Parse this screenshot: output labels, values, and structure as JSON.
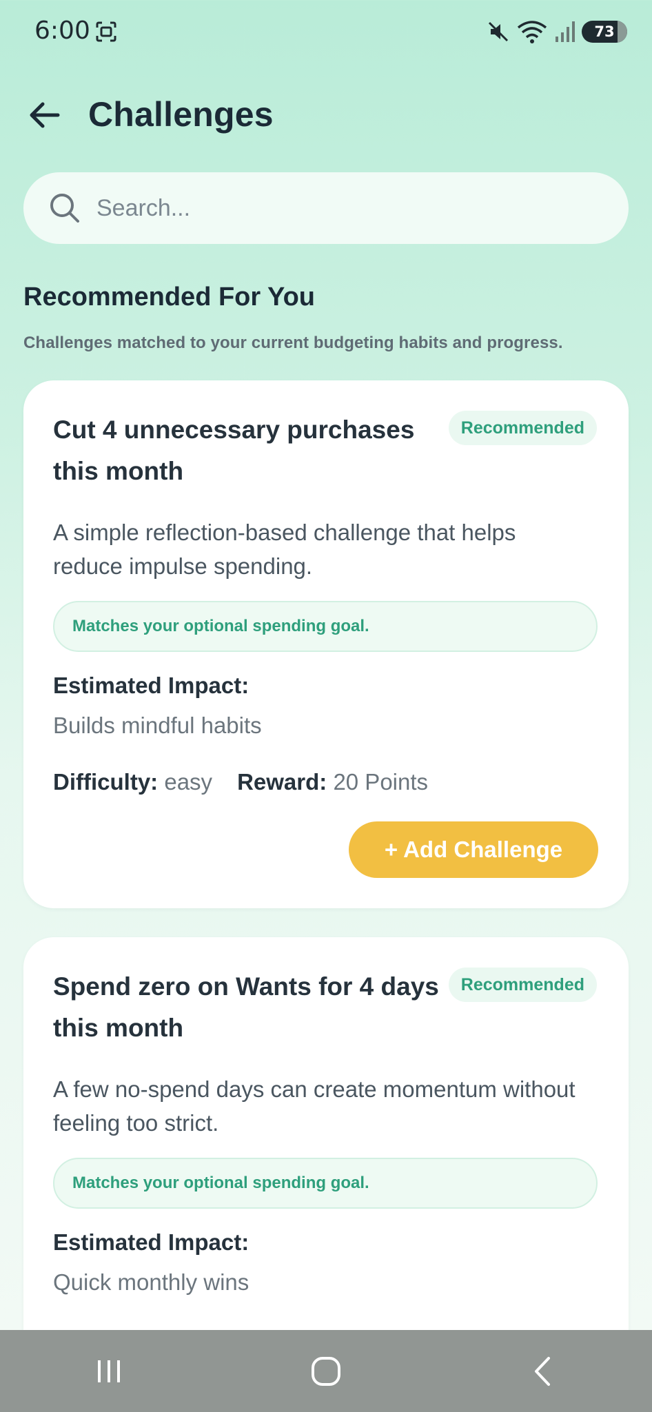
{
  "status_bar": {
    "time": "6:00",
    "battery": "73",
    "icons": [
      "screenshot-icon",
      "mute-icon",
      "wifi-icon",
      "signal-icon",
      "battery-icon"
    ]
  },
  "header": {
    "title": "Challenges",
    "back_icon": "arrow-left-icon"
  },
  "search": {
    "placeholder": "Search...",
    "value": ""
  },
  "section": {
    "title": "Recommended For You",
    "subtitle": "Challenges matched to your current budgeting habits and progress."
  },
  "challenges": [
    {
      "title": "Cut 4 unnecessary purchases this month",
      "badge": "Recommended",
      "description": "A simple reflection-based challenge that helps reduce impulse spending.",
      "match": "Matches your optional spending goal.",
      "impact_label": "Estimated Impact:",
      "impact": "Builds mindful habits",
      "difficulty_label": "Difficulty:",
      "difficulty": "easy",
      "reward_label": "Reward:",
      "reward": "20 Points",
      "button": "+ Add Challenge"
    },
    {
      "title": "Spend zero on Wants for 4 days this month",
      "badge": "Recommended",
      "description": "A few no-spend days can create momentum without feeling too strict.",
      "match": "Matches your optional spending goal.",
      "impact_label": "Estimated Impact:",
      "impact": "Quick monthly wins"
    }
  ],
  "colors": {
    "accent": "#2e9f7c",
    "button": "#f2bf42",
    "nav_bar": "#919693"
  },
  "nav": [
    "recents-icon",
    "home-icon",
    "back-icon"
  ]
}
